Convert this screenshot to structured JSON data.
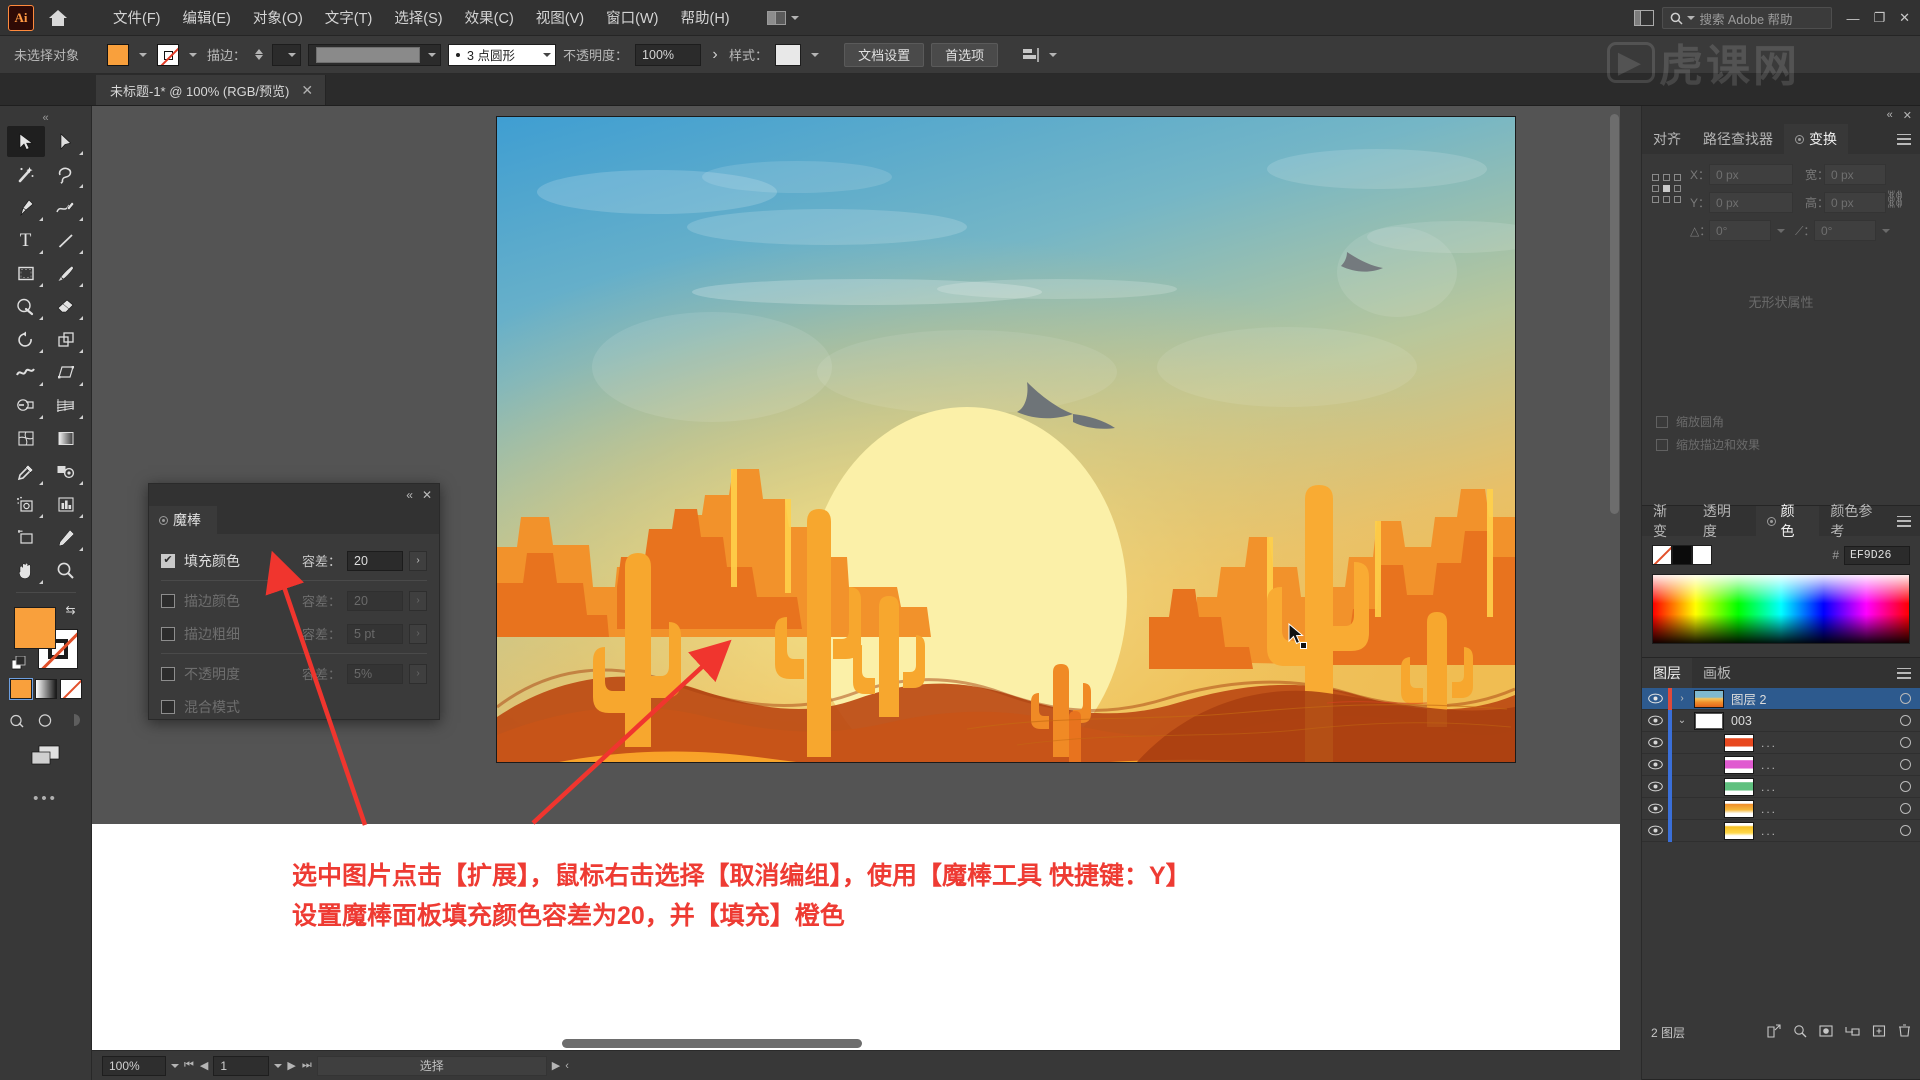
{
  "app": {
    "logo_text": "Ai",
    "home_icon": "home-icon"
  },
  "menubar": {
    "items": [
      {
        "label": "文件(F)"
      },
      {
        "label": "编辑(E)"
      },
      {
        "label": "对象(O)"
      },
      {
        "label": "文字(T)"
      },
      {
        "label": "选择(S)"
      },
      {
        "label": "效果(C)"
      },
      {
        "label": "视图(V)"
      },
      {
        "label": "窗口(W)"
      },
      {
        "label": "帮助(H)"
      }
    ],
    "search_placeholder": "搜索 Adobe 帮助",
    "minimize": "—",
    "maximize": "❐",
    "close": "✕"
  },
  "watermark": {
    "badge": "▶",
    "text": "虎课网"
  },
  "controlbar": {
    "selection_status": "未选择对象",
    "fill_color": "#F9A03C",
    "stroke_label": "描边：",
    "stroke_weight": "",
    "stroke_profile": "",
    "brush_def": "3 点圆形",
    "opacity_label": "不透明度：",
    "opacity_value": "100%",
    "style_label": "样式：",
    "doc_setup": "文档设置",
    "preferences": "首选项"
  },
  "tabbar": {
    "doc_title": "未标题-1* @ 100% (RGB/预览)",
    "close": "✕"
  },
  "toolbar": {
    "tools": [
      {
        "name": "selection-tool",
        "glyph": "▶",
        "active": true
      },
      {
        "name": "direct-selection-tool",
        "glyph": "▷",
        "active": false
      },
      {
        "name": "magic-wand-tool",
        "glyph": "✨",
        "active": false
      },
      {
        "name": "lasso-tool",
        "glyph": "◠",
        "active": false
      },
      {
        "name": "pen-tool",
        "glyph": "✒",
        "active": false
      },
      {
        "name": "curvature-tool",
        "glyph": "∿",
        "active": false
      },
      {
        "name": "type-tool",
        "glyph": "T",
        "active": false
      },
      {
        "name": "line-segment-tool",
        "glyph": "／",
        "active": false
      },
      {
        "name": "rectangle-tool",
        "glyph": "▭",
        "active": false
      },
      {
        "name": "paintbrush-tool",
        "glyph": "🖌",
        "active": false
      },
      {
        "name": "shaper-tool",
        "glyph": "◔",
        "active": false
      },
      {
        "name": "eraser-tool",
        "glyph": "◧",
        "active": false
      },
      {
        "name": "rotate-tool",
        "glyph": "↺",
        "active": false
      },
      {
        "name": "scale-tool",
        "glyph": "⧉",
        "active": false
      },
      {
        "name": "width-tool",
        "glyph": "≋",
        "active": false
      },
      {
        "name": "free-transform-tool",
        "glyph": "⬚",
        "active": false
      },
      {
        "name": "shape-builder-tool",
        "glyph": "◕",
        "active": false
      },
      {
        "name": "perspective-grid-tool",
        "glyph": "▨",
        "active": false
      },
      {
        "name": "mesh-tool",
        "glyph": "⊞",
        "active": false
      },
      {
        "name": "gradient-tool",
        "glyph": "▤",
        "active": false
      },
      {
        "name": "eyedropper-tool",
        "glyph": "✐",
        "active": false
      },
      {
        "name": "blend-tool",
        "glyph": "◉",
        "active": false
      },
      {
        "name": "symbol-sprayer-tool",
        "glyph": "⊛",
        "active": false
      },
      {
        "name": "column-graph-tool",
        "glyph": "📊",
        "active": false
      },
      {
        "name": "artboard-tool",
        "glyph": "⊡",
        "active": false
      },
      {
        "name": "slice-tool",
        "glyph": "✂",
        "active": false
      },
      {
        "name": "hand-tool",
        "glyph": "✋",
        "active": false
      },
      {
        "name": "zoom-tool",
        "glyph": "🔍",
        "active": false
      }
    ],
    "fill_color": "#F9A03C",
    "stroke_color": "#FFFFFF",
    "more_tools": "•••"
  },
  "magic_wand_panel": {
    "title": "魔棒",
    "collapse": "«",
    "close": "✕",
    "rows": [
      {
        "label": "填充颜色",
        "checked": true,
        "tolerance_label": "容差：",
        "tolerance_value": "20",
        "enabled": true
      },
      {
        "label": "描边颜色",
        "checked": false,
        "tolerance_label": "容差：",
        "tolerance_value": "20",
        "enabled": false
      },
      {
        "label": "描边粗细",
        "checked": false,
        "tolerance_label": "容差：",
        "tolerance_value": "5 pt",
        "enabled": false
      },
      {
        "label": "不透明度",
        "checked": false,
        "tolerance_label": "容差：",
        "tolerance_value": "5%",
        "enabled": false
      },
      {
        "label": "混合模式",
        "checked": false,
        "tolerance_label": "",
        "tolerance_value": "",
        "enabled": false
      }
    ]
  },
  "transform_panel": {
    "tabs": [
      {
        "label": "对齐",
        "active": false
      },
      {
        "label": "路径查找器",
        "active": false
      },
      {
        "label": "变换",
        "active": true
      }
    ],
    "fields": {
      "x_label": "X：",
      "x_value": "0 px",
      "y_label": "Y：",
      "y_value": "0 px",
      "w_label": "宽：",
      "w_value": "0 px",
      "h_label": "高：",
      "h_value": "0 px",
      "angle_label": "△：",
      "angle_value": "0°",
      "shear_label": "⟋：",
      "shear_value": "0°"
    },
    "checkboxes": [
      {
        "label": "缩放圆角",
        "checked": false
      },
      {
        "label": "缩放描边和效果",
        "checked": false
      }
    ],
    "empty_note": "无形状属性"
  },
  "color_panel": {
    "tabs": [
      {
        "label": "渐变",
        "active": false
      },
      {
        "label": "透明度",
        "active": false
      },
      {
        "label": "颜色",
        "active": true
      },
      {
        "label": "颜色参考",
        "active": false
      }
    ],
    "hash": "#",
    "hex_value": "EF9D26"
  },
  "layers_panel": {
    "tabs": [
      {
        "label": "图层",
        "active": true
      },
      {
        "label": "画板",
        "active": false
      }
    ],
    "rows": [
      {
        "name": "图层 2",
        "selected": true,
        "indent": 0,
        "expander": "›",
        "color": "#e04a3a",
        "thumb": "sunset"
      },
      {
        "name": "003",
        "selected": false,
        "indent": 1,
        "expander": "⌄",
        "color": "#3a6fd8",
        "thumb": "group"
      },
      {
        "name": "...",
        "selected": false,
        "indent": 2,
        "expander": "",
        "color": "#3a6fd8",
        "thumb": "red"
      },
      {
        "name": "...",
        "selected": false,
        "indent": 2,
        "expander": "",
        "color": "#3a6fd8",
        "thumb": "magenta"
      },
      {
        "name": "...",
        "selected": false,
        "indent": 2,
        "expander": "",
        "color": "#3a6fd8",
        "thumb": "green"
      },
      {
        "name": "...",
        "selected": false,
        "indent": 2,
        "expander": "",
        "color": "#3a6fd8",
        "thumb": "orange"
      },
      {
        "name": "...",
        "selected": false,
        "indent": 2,
        "expander": "",
        "color": "#3a6fd8",
        "thumb": "yellow"
      }
    ],
    "footer_count": "2 图层",
    "footer_icons": [
      "locate-object-icon",
      "search-icon",
      "make-mask-icon",
      "new-sublayer-icon",
      "new-layer-icon",
      "delete-layer-icon"
    ]
  },
  "statusbar": {
    "zoom": "100%",
    "page": "1",
    "status_text": "选择"
  },
  "caption": {
    "line1": "选中图片点击【扩展】，鼠标右击选择【取消编组】，使用【魔棒工具 快捷键：Y】",
    "line2": "设置魔棒面板填充颜色容差为20，并【填充】橙色"
  },
  "artwork": {
    "title": "desert-sunset-illustration",
    "colors": {
      "sky_top": "#3C9FD0",
      "sky_mid": "#8FC2BC",
      "sky_glow": "#E8C068",
      "sun": "#FBF0A8",
      "mesa_light": "#F7A02C",
      "mesa_mid": "#E8731E",
      "dune_dark": "#BC4A14",
      "sand": "#F9A227",
      "cactus": "#F7A72E",
      "bird": "#6E7478"
    }
  }
}
